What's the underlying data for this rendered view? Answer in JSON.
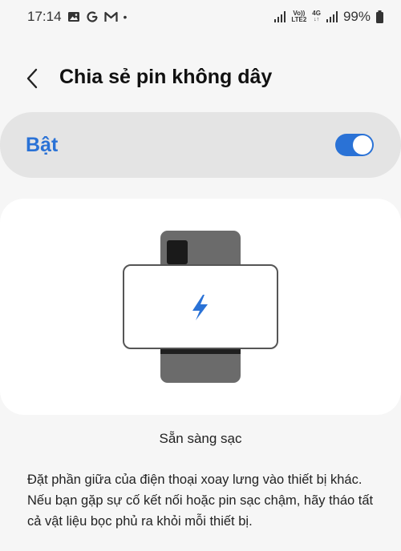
{
  "status_bar": {
    "time": "17:14",
    "network_label_top": "Vo))",
    "network_label_bottom": "LTE2",
    "network_type": "4G",
    "battery": "99%",
    "icons": [
      "image-icon",
      "g-icon",
      "gmail-icon",
      "dot-icon",
      "signal-icon",
      "volte-icon",
      "4g-icon",
      "signal-icon",
      "battery-icon"
    ]
  },
  "header": {
    "title": "Chia sẻ pin không dây"
  },
  "master_switch": {
    "label": "Bật",
    "state": "on",
    "accent_color": "#2a72d6"
  },
  "illustration": {
    "icon": "lightning-bolt-icon"
  },
  "status_text": "Sẵn sàng sạc",
  "description": {
    "line1": "Đặt phần giữa của điện thoại xoay lưng vào thiết bị khác.",
    "line2": "Nếu bạn gặp sự cố kết nối hoặc pin sạc chậm, hãy tháo tất cả vật liệu bọc phủ ra khỏi mỗi thiết bị."
  }
}
